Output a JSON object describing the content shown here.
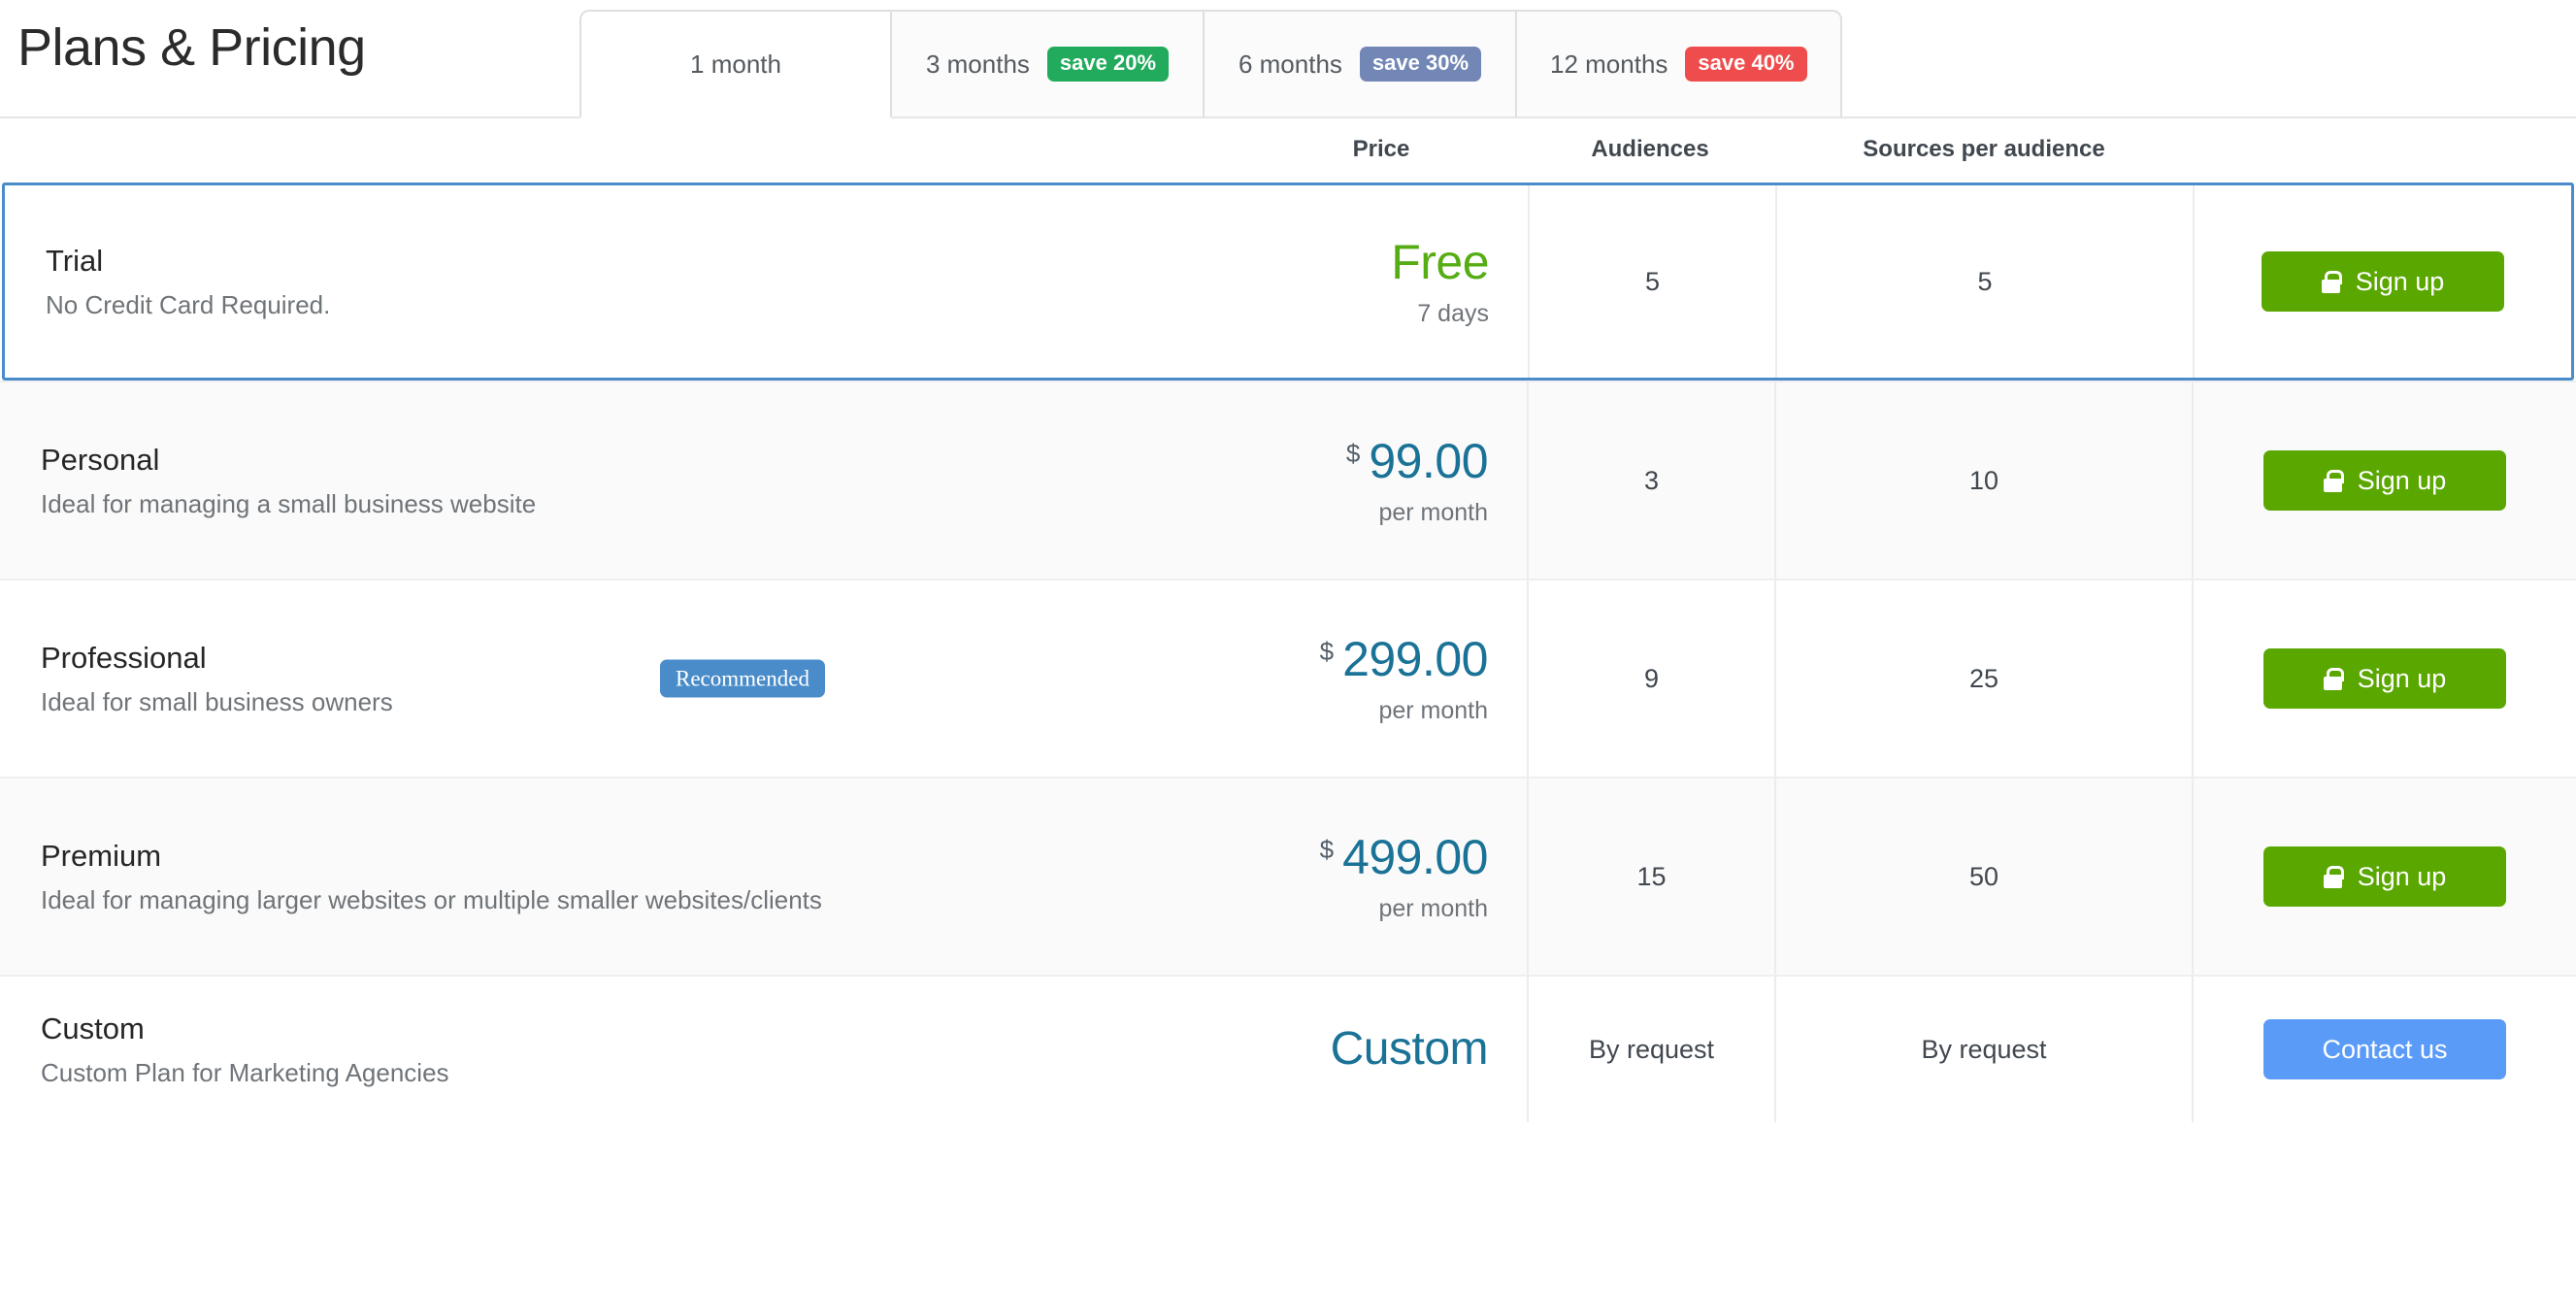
{
  "header": {
    "title": "Plans & Pricing",
    "tabs": [
      {
        "label": "1 month",
        "badge": null,
        "badge_color": null,
        "active": true
      },
      {
        "label": "3 months",
        "badge": "save 20%",
        "badge_color": "#22ab5c",
        "active": false
      },
      {
        "label": "6 months",
        "badge": "save 30%",
        "badge_color": "#7287b5",
        "active": false
      },
      {
        "label": "12 months",
        "badge": "save 40%",
        "badge_color": "#ef4d4d",
        "active": false
      }
    ]
  },
  "columns": {
    "price": "Price",
    "audiences": "Audiences",
    "sources": "Sources per audience"
  },
  "plans": [
    {
      "name": "Trial",
      "description": "No Credit Card Required.",
      "recommended": null,
      "currency": "",
      "price": "Free",
      "period": "7 days",
      "audiences": "5",
      "sources": "5",
      "cta": "Sign up",
      "cta_icon": "lock-icon"
    },
    {
      "name": "Personal",
      "description": "Ideal for managing a small business website",
      "recommended": null,
      "currency": "$",
      "price": "99.00",
      "period": "per month",
      "audiences": "3",
      "sources": "10",
      "cta": "Sign up",
      "cta_icon": "lock-icon"
    },
    {
      "name": "Professional",
      "description": "Ideal for small business owners",
      "recommended": "Recommended",
      "currency": "$",
      "price": "299.00",
      "period": "per month",
      "audiences": "9",
      "sources": "25",
      "cta": "Sign up",
      "cta_icon": "lock-icon"
    },
    {
      "name": "Premium",
      "description": "Ideal for managing larger websites or multiple smaller websites/clients",
      "recommended": null,
      "currency": "$",
      "price": "499.00",
      "period": "per month",
      "audiences": "15",
      "sources": "50",
      "cta": "Sign up",
      "cta_icon": "lock-icon"
    },
    {
      "name": "Custom",
      "description": "Custom Plan for Marketing Agencies",
      "recommended": null,
      "currency": "",
      "price": "Custom",
      "period": "",
      "audiences": "By request",
      "sources": "By request",
      "cta": "Contact us",
      "cta_icon": null
    }
  ],
  "colors": {
    "accent_blue": "#4a8cc9",
    "price_teal": "#1a7296",
    "free_green": "#56ad13",
    "signup_green": "#5aa700",
    "contact_blue": "#5b9bf8"
  }
}
